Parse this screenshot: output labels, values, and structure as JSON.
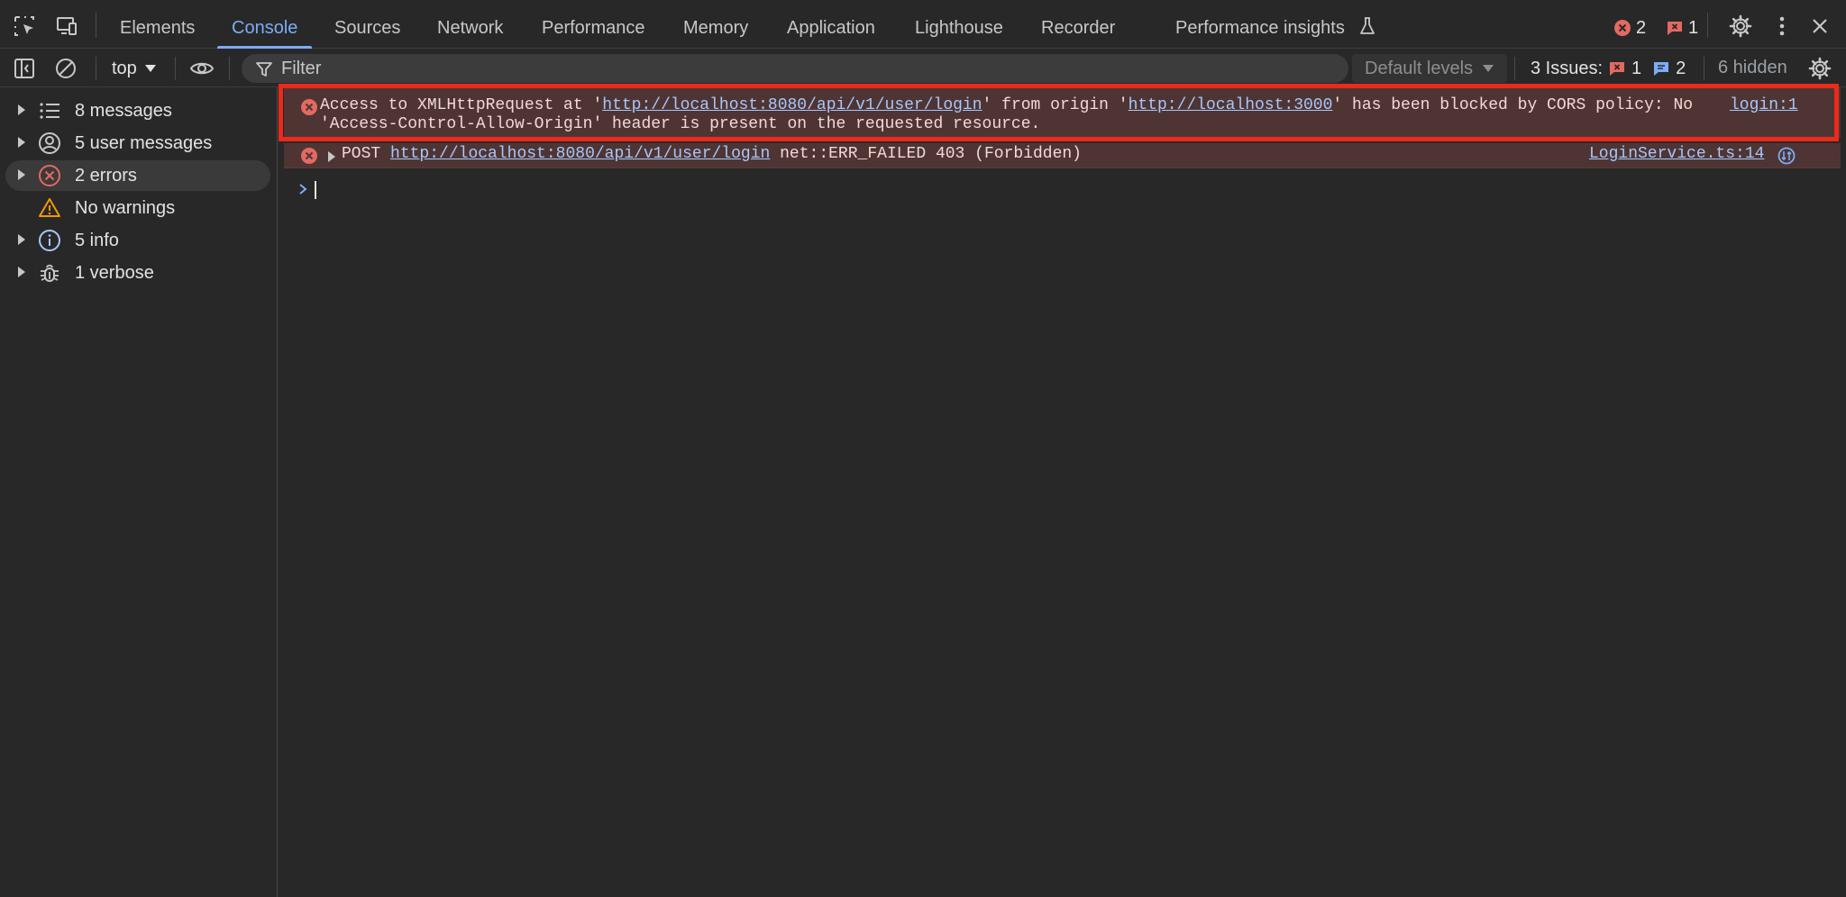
{
  "tabs": {
    "items": [
      {
        "label": "Elements"
      },
      {
        "label": "Console"
      },
      {
        "label": "Sources"
      },
      {
        "label": "Network"
      },
      {
        "label": "Performance"
      },
      {
        "label": "Memory"
      },
      {
        "label": "Application"
      },
      {
        "label": "Lighthouse"
      },
      {
        "label": "Recorder"
      },
      {
        "label": "Performance insights"
      }
    ],
    "active": "Console",
    "error_count": "2",
    "issue_count": "1"
  },
  "toolbar": {
    "context": "top",
    "filter_placeholder": "Filter",
    "levels": "Default levels",
    "issues_label": "3 Issues:",
    "issues_errors": "1",
    "issues_info": "2",
    "hidden": "6 hidden"
  },
  "sidebar": {
    "items": [
      {
        "label": "8 messages",
        "icon": "list-icon"
      },
      {
        "label": "5 user messages",
        "icon": "user-icon"
      },
      {
        "label": "2 errors",
        "icon": "error-icon"
      },
      {
        "label": "No warnings",
        "icon": "warning-icon"
      },
      {
        "label": "5 info",
        "icon": "info-icon"
      },
      {
        "label": "1 verbose",
        "icon": "bug-icon"
      }
    ],
    "selected": "2 errors"
  },
  "console": {
    "messages": [
      {
        "level": "error",
        "text_1": "Access to XMLHttpRequest at '",
        "url_1": "http://localhost:8080/api/v1/user/login",
        "text_2": "' from origin '",
        "url_2": "http://localhost:3000",
        "text_3": "' has been blocked by CORS policy: No",
        "text_4": "'Access-Control-Allow-Origin' header is present on the requested resource.",
        "source": "login:1"
      },
      {
        "level": "error",
        "method": "POST",
        "url": "http://localhost:8080/api/v1/user/login",
        "status": "net::ERR_FAILED 403 (Forbidden)",
        "source": "LoginService.ts:14"
      }
    ]
  },
  "colors": {
    "accent": "#7cacf8",
    "error_bg": "#4e3534",
    "error_icon": "#e46962",
    "highlight": "#ea2a1a",
    "warning": "#f29900",
    "info": "#a8c7fa"
  }
}
